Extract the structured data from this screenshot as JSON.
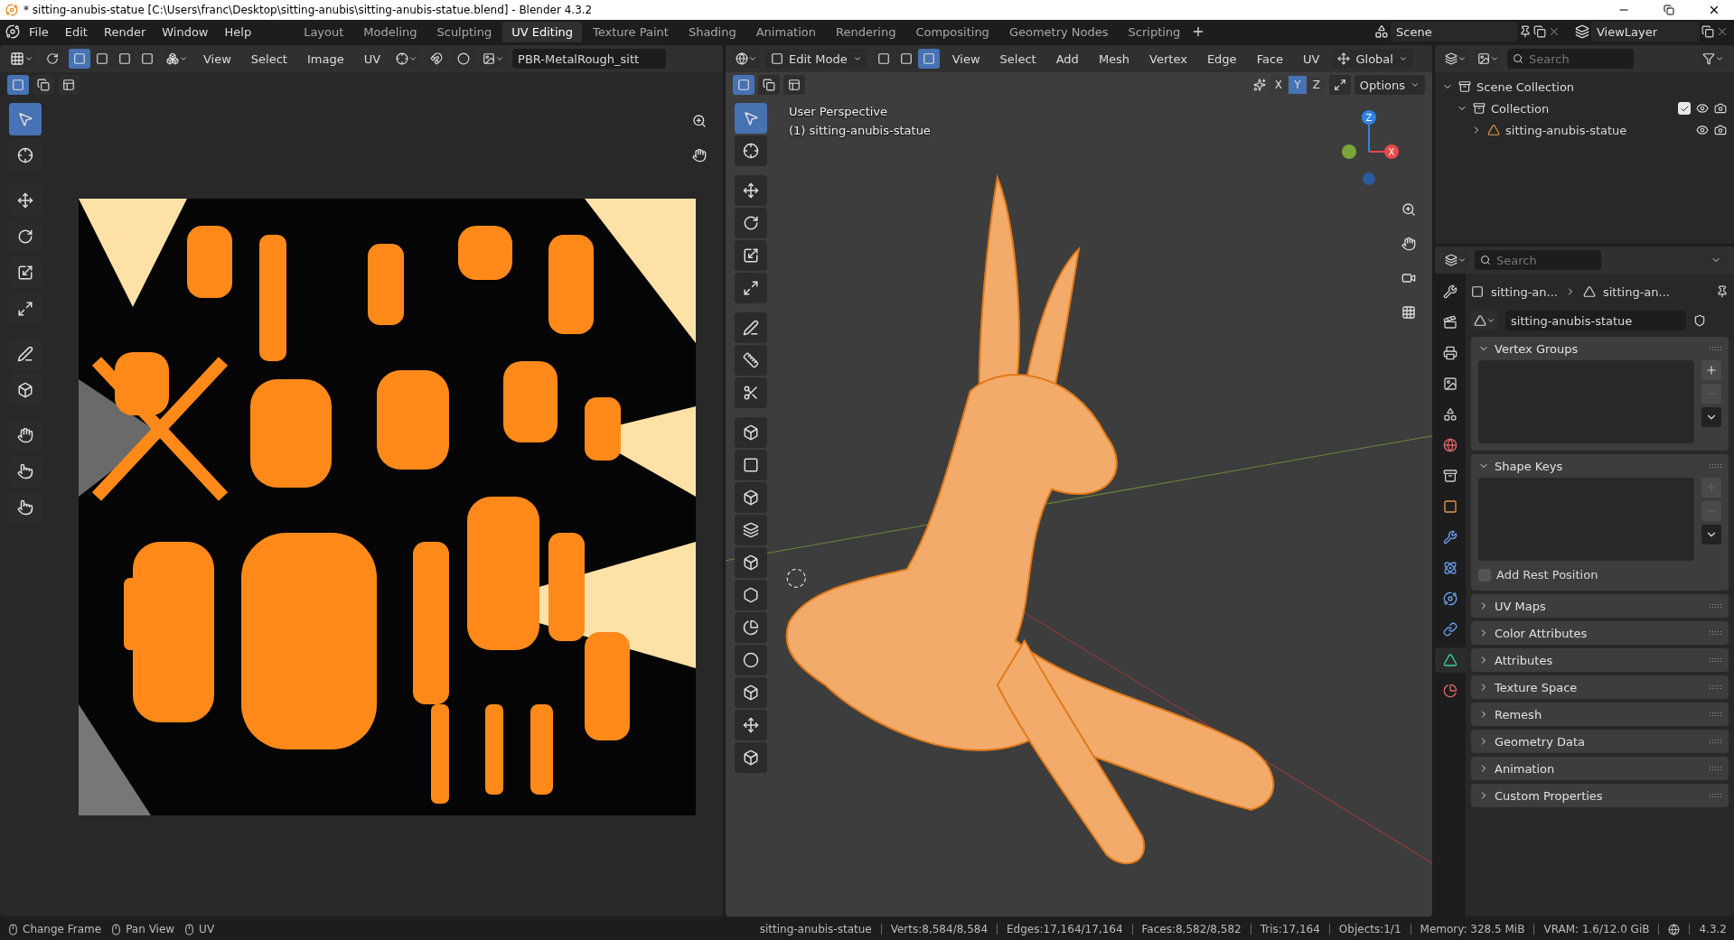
{
  "window": {
    "title": "* sitting-anubis-statue [C:\\Users\\franc\\Desktop\\sitting-anubis\\sitting-anubis-statue.blend] - Blender 4.3.2"
  },
  "menu": [
    "File",
    "Edit",
    "Render",
    "Window",
    "Help"
  ],
  "workspaces": [
    {
      "label": "Layout",
      "selected": false
    },
    {
      "label": "Modeling",
      "selected": false
    },
    {
      "label": "Sculpting",
      "selected": false
    },
    {
      "label": "UV Editing",
      "selected": true
    },
    {
      "label": "Texture Paint",
      "selected": false
    },
    {
      "label": "Shading",
      "selected": false
    },
    {
      "label": "Animation",
      "selected": false
    },
    {
      "label": "Rendering",
      "selected": false
    },
    {
      "label": "Compositing",
      "selected": false
    },
    {
      "label": "Geometry Nodes",
      "selected": false
    },
    {
      "label": "Scripting",
      "selected": false
    }
  ],
  "scene": "Scene",
  "view_layer": "ViewLayer",
  "uv_editor": {
    "menus": [
      "View",
      "Select",
      "Image",
      "UV"
    ],
    "image_name": "PBR-MetalRough_sitt",
    "select_modes": [
      {
        "selected": true
      },
      {
        "selected": false
      },
      {
        "selected": false
      },
      {
        "selected": false
      }
    ]
  },
  "viewport": {
    "mode": "Edit Mode",
    "select_modes": [
      {
        "selected": false
      },
      {
        "selected": false
      },
      {
        "selected": true
      }
    ],
    "menus": [
      "View",
      "Select",
      "Add",
      "Mesh",
      "Vertex",
      "Edge",
      "Face",
      "UV"
    ],
    "orientation": "Global",
    "axes": [
      {
        "label": "X",
        "selected": false
      },
      {
        "label": "Y",
        "selected": true
      },
      {
        "label": "Z",
        "selected": false
      }
    ],
    "options": "Options",
    "overlay_text": [
      "User Perspective",
      "(1) sitting-anubis-statue"
    ],
    "gizmo_labels": [
      "Z",
      "X"
    ]
  },
  "outliner": {
    "search": {
      "placeholder": "Search"
    },
    "tree": [
      {
        "label": "Scene Collection",
        "children": [
          {
            "label": "Collection",
            "checked": true,
            "children": [
              {
                "label": "sitting-anubis-statue",
                "expanded": false
              }
            ]
          }
        ]
      }
    ]
  },
  "properties": {
    "search": {
      "placeholder": "Search"
    },
    "tabs": [
      {
        "selected": false
      },
      {
        "selected": false
      },
      {
        "selected": false
      },
      {
        "selected": false
      },
      {
        "selected": false
      },
      {
        "selected": false
      },
      {
        "selected": false
      },
      {
        "selected": false
      },
      {
        "selected": false
      },
      {
        "selected": false
      },
      {
        "selected": false
      },
      {
        "selected": false
      },
      {
        "selected": true
      },
      {
        "selected": false
      }
    ],
    "breadcrumb": [
      "sitting-an...",
      "sitting-an..."
    ],
    "mesh_name": "sitting-anubis-statue",
    "panels": [
      {
        "title": "Vertex Groups",
        "expanded": true,
        "kind": "list"
      },
      {
        "title": "Shape Keys",
        "expanded": true,
        "kind": "shapekeys"
      },
      {
        "title": "UV Maps",
        "expanded": false
      },
      {
        "title": "Color Attributes",
        "expanded": false
      },
      {
        "title": "Attributes",
        "expanded": false
      },
      {
        "title": "Texture Space",
        "expanded": false
      },
      {
        "title": "Remesh",
        "expanded": false
      },
      {
        "title": "Geometry Data",
        "expanded": false
      },
      {
        "title": "Animation",
        "expanded": false
      },
      {
        "title": "Custom Properties",
        "expanded": false
      }
    ],
    "add_rest_position": {
      "label": "Add Rest Position",
      "checked": false
    }
  },
  "status_bar": {
    "hints": [
      "Change Frame",
      "Pan View",
      "UV"
    ],
    "stats": [
      "sitting-anubis-statue",
      "Verts:8,584/8,584",
      "Edges:17,164/17,164",
      "Faces:8,582/8,582",
      "Tris:17,164",
      "Objects:1/1",
      "Memory: 328.5 MiB",
      "VRAM: 1.6/12.0 GiB"
    ],
    "version": "4.3.2"
  }
}
